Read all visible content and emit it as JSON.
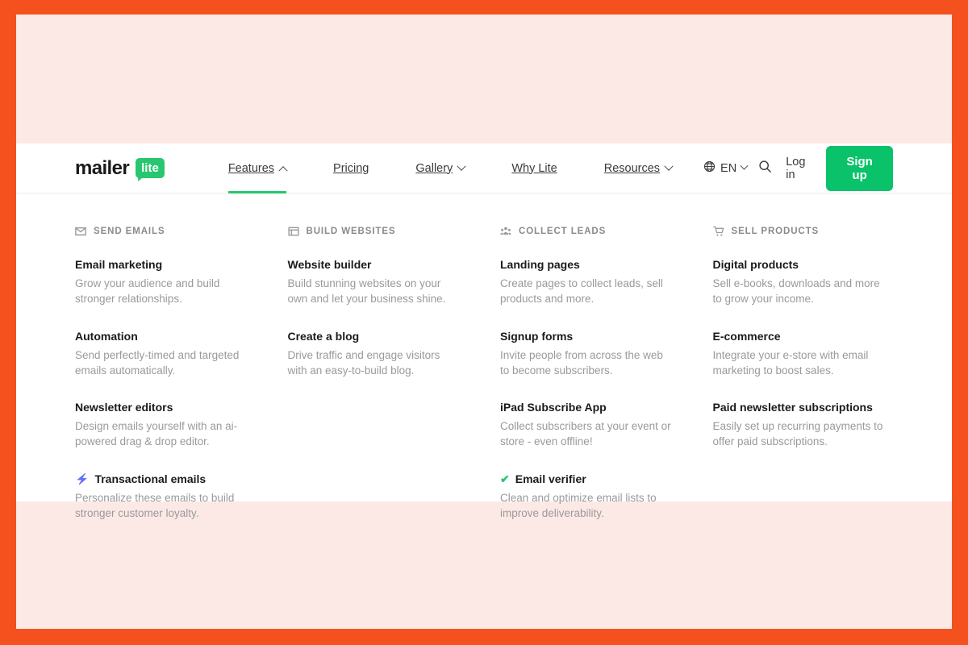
{
  "theme": {
    "border_color": "#F4511E",
    "page_background": "#FCE9E6",
    "accent_green": "#28C76F",
    "signup_button_color": "#09C269"
  },
  "header": {
    "logo": {
      "word": "mailer",
      "badge": "lite"
    },
    "nav": [
      {
        "label": "Features",
        "has_chevron": true,
        "chevron": "up",
        "active": true
      },
      {
        "label": "Pricing",
        "has_chevron": false,
        "chevron": "",
        "active": false
      },
      {
        "label": "Gallery",
        "has_chevron": true,
        "chevron": "down",
        "active": false
      },
      {
        "label": "Why Lite",
        "has_chevron": false,
        "chevron": "",
        "active": false
      },
      {
        "label": "Resources",
        "has_chevron": true,
        "chevron": "down",
        "active": false
      }
    ],
    "language": {
      "icon": "globe-icon",
      "label": "EN"
    },
    "search": {
      "icon": "search-icon"
    },
    "login_label": "Log in",
    "signup_label": "Sign up"
  },
  "mega_menu": {
    "columns": [
      {
        "icon": "envelope-icon",
        "heading": "SEND EMAILS",
        "items": [
          {
            "title": "Email marketing",
            "desc": "Grow your audience and build stronger relationships.",
            "badge": ""
          },
          {
            "title": "Automation",
            "desc": "Send perfectly-timed and targeted emails automatically.",
            "badge": ""
          },
          {
            "title": "Newsletter editors",
            "desc": "Design emails yourself with an ai-powered drag & drop editor.",
            "badge": ""
          },
          {
            "title": "Transactional emails",
            "desc": "Personalize these emails to build stronger customer loyalty.",
            "badge": "bolt"
          }
        ]
      },
      {
        "icon": "browser-window-icon",
        "heading": "BUILD WEBSITES",
        "items": [
          {
            "title": "Website builder",
            "desc": "Build stunning websites on your own and let your business shine.",
            "badge": ""
          },
          {
            "title": "Create a blog",
            "desc": "Drive traffic and engage visitors with an easy-to-build blog.",
            "badge": ""
          }
        ]
      },
      {
        "icon": "people-group-icon",
        "heading": "COLLECT LEADS",
        "items": [
          {
            "title": "Landing pages",
            "desc": "Create pages to collect leads, sell products and more.",
            "badge": ""
          },
          {
            "title": "Signup forms",
            "desc": "Invite people from across the web to become subscribers.",
            "badge": ""
          },
          {
            "title": "iPad Subscribe App",
            "desc": "Collect subscribers at your event or store - even offline!",
            "badge": ""
          },
          {
            "title": "Email verifier",
            "desc": "Clean and optimize email lists to improve deliverability.",
            "badge": "check"
          }
        ]
      },
      {
        "icon": "shopping-cart-icon",
        "heading": "SELL PRODUCTS",
        "items": [
          {
            "title": "Digital products",
            "desc": "Sell e-books, downloads and more to grow your income.",
            "badge": ""
          },
          {
            "title": "E-commerce",
            "desc": "Integrate your e-store with email marketing to boost sales.",
            "badge": ""
          },
          {
            "title": "Paid newsletter subscriptions",
            "desc": "Easily set up recurring payments to offer paid subscriptions.",
            "badge": ""
          }
        ]
      }
    ]
  }
}
